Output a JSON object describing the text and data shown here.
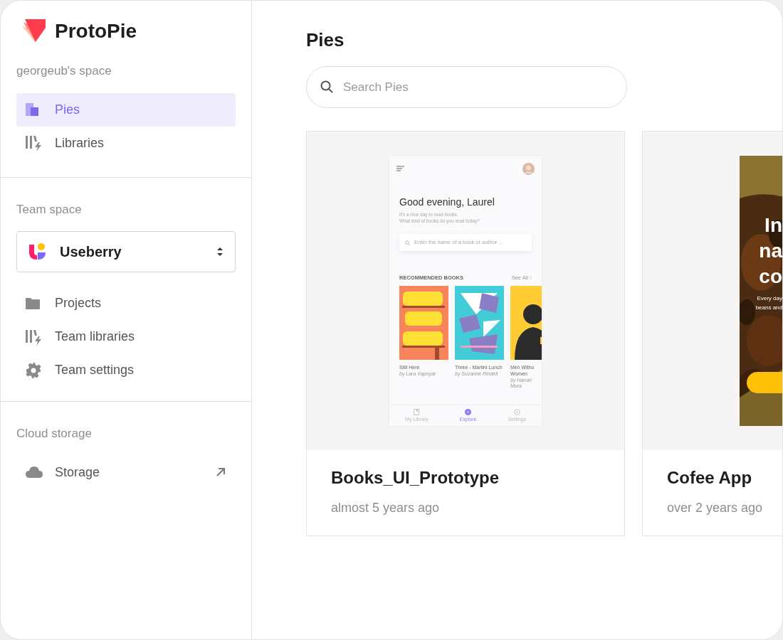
{
  "brand": {
    "name": "ProtoPie"
  },
  "sidebar": {
    "sections": [
      {
        "heading": "georgeub's space",
        "items": [
          {
            "label": "Pies",
            "selected": true,
            "external": false
          },
          {
            "label": "Libraries",
            "selected": false,
            "external": false
          }
        ]
      },
      {
        "heading": "Team space",
        "team_picker": {
          "value": "Useberry"
        },
        "items": [
          {
            "label": "Projects",
            "selected": false,
            "external": false
          },
          {
            "label": "Team libraries",
            "selected": false,
            "external": false
          },
          {
            "label": "Team settings",
            "selected": false,
            "external": false
          }
        ]
      },
      {
        "heading": "Cloud storage",
        "items": [
          {
            "label": "Storage",
            "selected": false,
            "external": true
          }
        ]
      }
    ]
  },
  "main": {
    "title": "Pies",
    "search": {
      "placeholder": "Search Pies"
    },
    "pies": [
      {
        "name": "Books_UI_Prototype",
        "updated": "almost 5 years ago",
        "preview": {
          "kind": "books_app",
          "greeting": "Good evening, Laurel",
          "subtitle_lines": [
            "It's a nice day to read books.",
            "What kind of books do you read today?"
          ],
          "search_placeholder": "Enter the name of a book or author ...",
          "section_title": "RECOMMENDED BOOKS",
          "see_all": "See All",
          "books": [
            {
              "title": "Still Here",
              "author": "by Lara Vapnyar"
            },
            {
              "title": "Three - Martini Lunch",
              "author": "by Suzanne Rindell"
            },
            {
              "title": "Men Witho Women",
              "author": "by Haruki Mura"
            }
          ],
          "tabs": [
            {
              "label": "My Library",
              "selected": false
            },
            {
              "label": "Explore",
              "selected": true
            },
            {
              "label": "Settings",
              "selected": false
            }
          ]
        }
      },
      {
        "name": "Cofee App",
        "updated": "over 2 years ago",
        "preview": {
          "kind": "coffee_app",
          "headline_lines": [
            "In",
            "na",
            "co"
          ],
          "text_lines": [
            "Every day",
            "beans and"
          ]
        }
      }
    ]
  }
}
